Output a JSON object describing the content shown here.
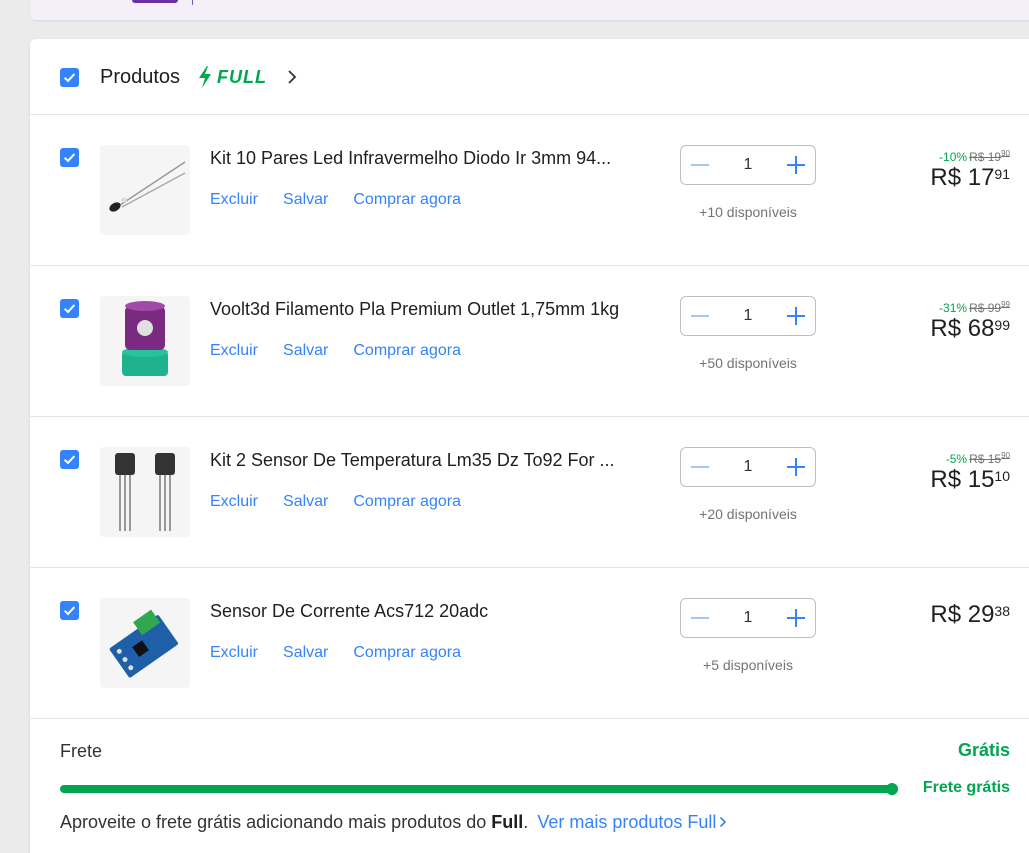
{
  "header": {
    "title": "Produtos",
    "badge": "FULL"
  },
  "colors": {
    "accent": "#3483fa",
    "green": "#00a650"
  },
  "items": [
    {
      "title": "Kit 10 Pares Led Infravermelho Diodo Ir 3mm 94...",
      "actions": {
        "delete": "Excluir",
        "save": "Salvar",
        "buy_now": "Comprar agora"
      },
      "quantity": "1",
      "available": "+10 disponíveis",
      "discount": "-10%",
      "old_price": "R$ 19",
      "old_cents": "90",
      "price": "R$ 17",
      "cents": "91"
    },
    {
      "title": "Voolt3d Filamento Pla Premium Outlet 1,75mm 1kg",
      "actions": {
        "delete": "Excluir",
        "save": "Salvar",
        "buy_now": "Comprar agora"
      },
      "quantity": "1",
      "available": "+50 disponíveis",
      "discount": "-31%",
      "old_price": "R$ 99",
      "old_cents": "99",
      "price": "R$ 68",
      "cents": "99"
    },
    {
      "title": "Kit 2 Sensor De Temperatura Lm35 Dz To92 For ...",
      "actions": {
        "delete": "Excluir",
        "save": "Salvar",
        "buy_now": "Comprar agora"
      },
      "quantity": "1",
      "available": "+20 disponíveis",
      "discount": "-5%",
      "old_price": "R$ 15",
      "old_cents": "90",
      "price": "R$ 15",
      "cents": "10"
    },
    {
      "title": "Sensor De Corrente Acs712 20adc",
      "actions": {
        "delete": "Excluir",
        "save": "Salvar",
        "buy_now": "Comprar agora"
      },
      "quantity": "1",
      "available": "+5 disponíveis",
      "price": "R$ 29",
      "cents": "38"
    }
  ],
  "shipping": {
    "label": "Frete",
    "value": "Grátis",
    "progress_label": "Frete grátis",
    "progress": 1.0,
    "note_prefix": "Aproveite o frete grátis adicionando mais produtos do",
    "note_bold": "Full",
    "note_dot": ".",
    "link": "Ver mais produtos Full"
  }
}
